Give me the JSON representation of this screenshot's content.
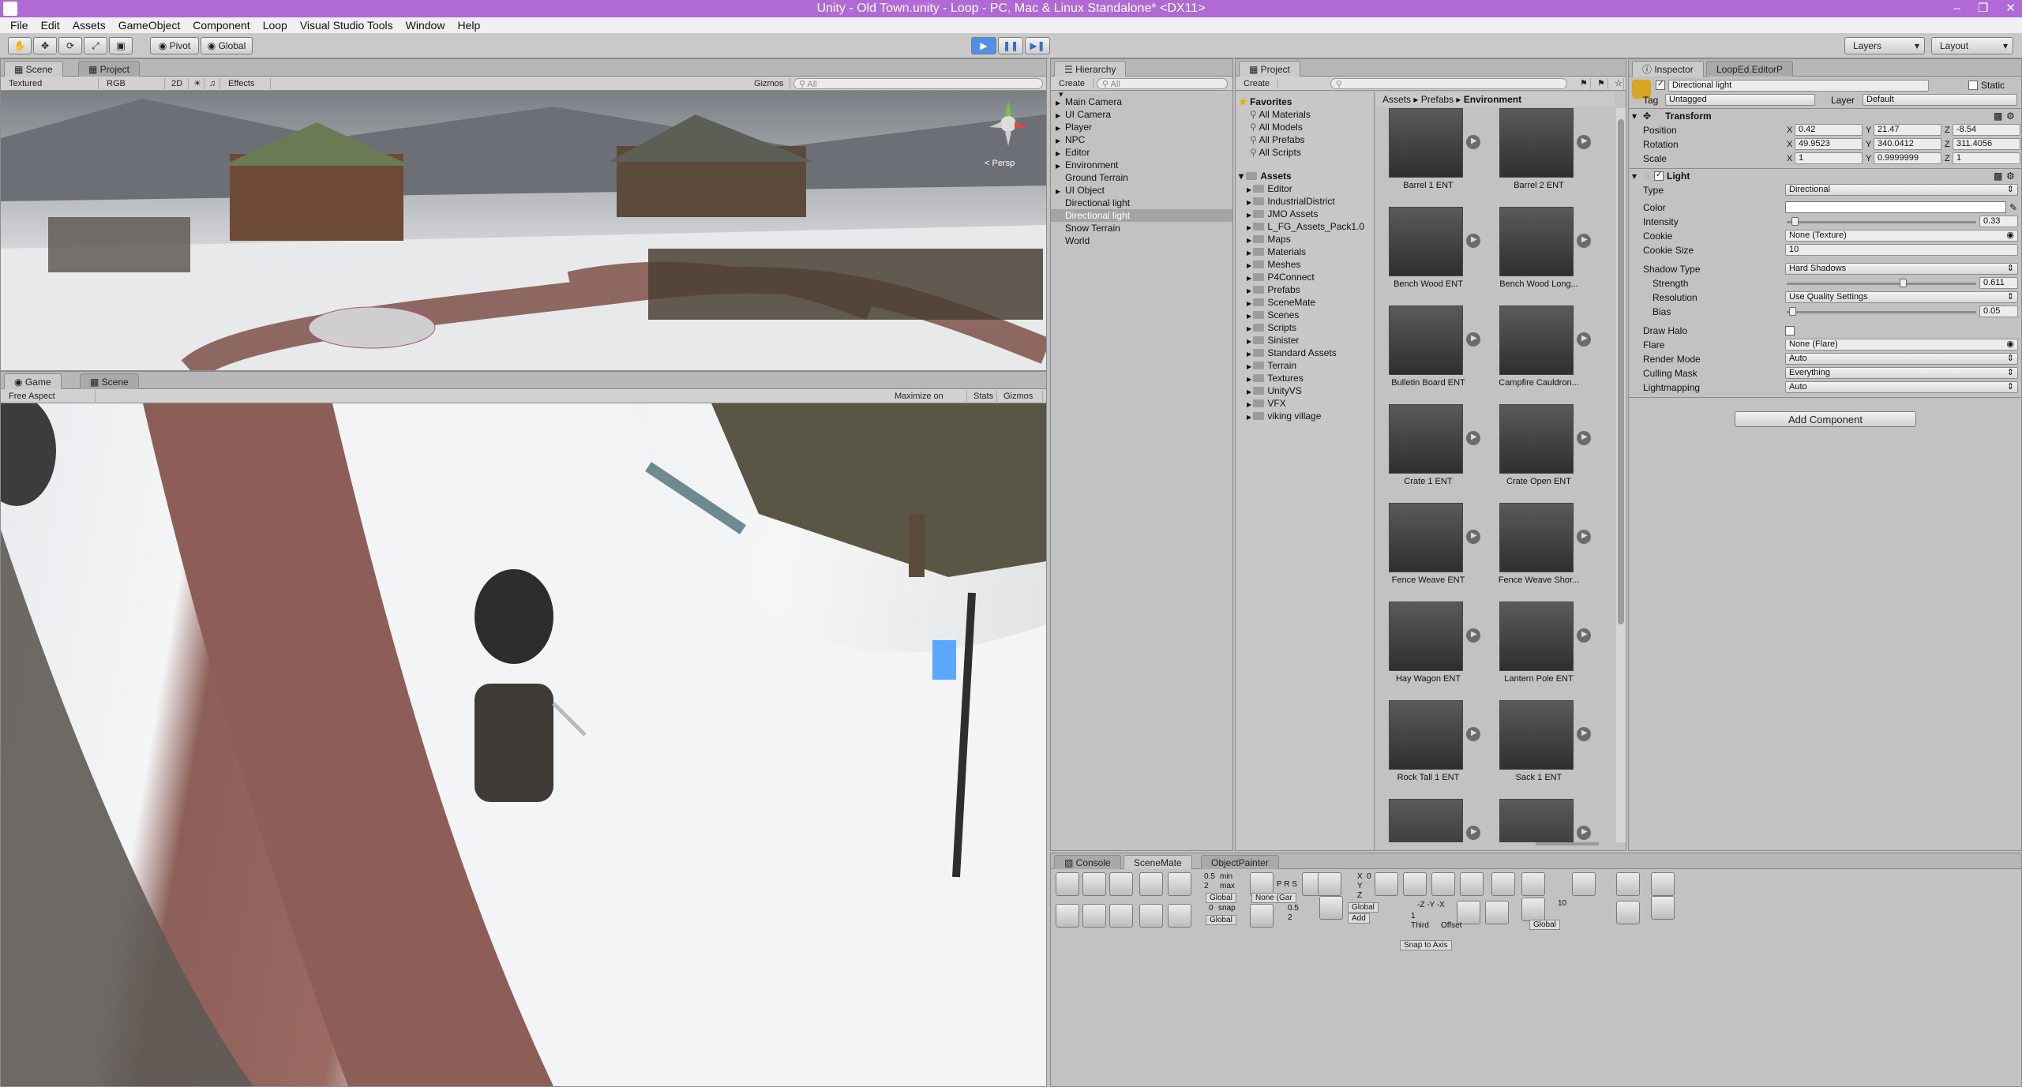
{
  "window": {
    "title": "Unity - Old Town.unity - Loop - PC, Mac & Linux Standalone* <DX11>"
  },
  "menu": [
    "File",
    "Edit",
    "Assets",
    "GameObject",
    "Component",
    "Loop",
    "Visual Studio Tools",
    "Window",
    "Help"
  ],
  "toolbar": {
    "pivot": "Pivot",
    "global": "Global",
    "layers": "Layers",
    "layout": "Layout"
  },
  "scene_panel": {
    "tabs": [
      "Scene",
      "Project"
    ],
    "bar": {
      "textured": "Textured",
      "rgb": "RGB",
      "mode2d": "2D",
      "effects": "Effects",
      "gizmos": "Gizmos",
      "search_placeholder": "All"
    },
    "gizmo_label": "< Persp"
  },
  "game_panel": {
    "tabs": [
      "Game",
      "Scene"
    ],
    "bar": {
      "aspect": "Free Aspect",
      "maximize": "Maximize on Play",
      "stats": "Stats",
      "gizmos": "Gizmos"
    }
  },
  "hierarchy": {
    "tab": "Hierarchy",
    "create": "Create",
    "search_placeholder": "All",
    "items": [
      {
        "label": "Main Camera",
        "expand": true
      },
      {
        "label": "UI Camera",
        "expand": true
      },
      {
        "label": "Player",
        "expand": true
      },
      {
        "label": "NPC",
        "expand": true
      },
      {
        "label": "Editor",
        "expand": true
      },
      {
        "label": "Environment",
        "expand": true
      },
      {
        "label": "Ground Terrain",
        "expand": false
      },
      {
        "label": "UI Object",
        "expand": true
      },
      {
        "label": "Directional light",
        "expand": false
      },
      {
        "label": "Directional light",
        "expand": false,
        "selected": true
      },
      {
        "label": "Snow Terrain",
        "expand": false
      },
      {
        "label": "World",
        "expand": false
      }
    ]
  },
  "project": {
    "tab": "Project",
    "create": "Create",
    "favorites_label": "Favorites",
    "favorites": [
      "All Materials",
      "All Models",
      "All Prefabs",
      "All Scripts"
    ],
    "assets_label": "Assets",
    "folders": [
      "Editor",
      "IndustrialDistrict",
      "JMO Assets",
      "L_FG_Assets_Pack1.0",
      "Maps",
      "Materials",
      "Meshes",
      "P4Connect",
      "Prefabs",
      "SceneMate",
      "Scenes",
      "Scripts",
      "Sinister",
      "Standard Assets",
      "Terrain",
      "Textures",
      "UnityVS",
      "VFX",
      "viking village"
    ],
    "breadcrumb": [
      "Assets",
      "Prefabs",
      "Environment"
    ],
    "assets": [
      "Barrel 1 ENT",
      "Barrel 2 ENT",
      "Bench Wood ENT",
      "Bench Wood Long...",
      "Bulletin Board ENT",
      "Campfire Cauldron...",
      "Crate 1 ENT",
      "Crate Open ENT",
      "Fence Weave ENT",
      "Fence Weave Shor...",
      "Hay Wagon ENT",
      "Lantern Pole ENT",
      "Rock Tall 1 ENT",
      "Sack 1 ENT",
      "",
      ""
    ]
  },
  "inspector": {
    "tabs": [
      "Inspector",
      "LoopEd.EditorP"
    ],
    "object_name": "Directional light",
    "static": "Static",
    "tag_label": "Tag",
    "tag": "Untagged",
    "layer_label": "Layer",
    "layer": "Default",
    "transform": {
      "title": "Transform",
      "position_label": "Position",
      "position": [
        "0.42",
        "21.47",
        "-8.54"
      ],
      "rotation_label": "Rotation",
      "rotation": [
        "49.9523",
        "340.0412",
        "311.4056"
      ],
      "scale_label": "Scale",
      "scale": [
        "1",
        "0.9999999",
        "1"
      ]
    },
    "light": {
      "title": "Light",
      "type_label": "Type",
      "type": "Directional",
      "color_label": "Color",
      "color": "#ffffff",
      "intensity_label": "Intensity",
      "intensity": "0.33",
      "intensity_fraction": 0.04,
      "cookie_label": "Cookie",
      "cookie": "None (Texture)",
      "cookie_size_label": "Cookie Size",
      "cookie_size": "10",
      "shadow_type_label": "Shadow Type",
      "shadow_type": "Hard Shadows",
      "strength_label": "Strength",
      "strength": "0.611",
      "strength_fraction": 0.611,
      "resolution_label": "Resolution",
      "resolution": "Use Quality Settings",
      "bias_label": "Bias",
      "bias": "0.05",
      "bias_fraction": 0.03,
      "draw_halo_label": "Draw Halo",
      "flare_label": "Flare",
      "flare": "None (Flare)",
      "render_mode_label": "Render Mode",
      "render_mode": "Auto",
      "culling_label": "Culling Mask",
      "culling": "Everything",
      "lightmapping_label": "Lightmapping",
      "lightmapping": "Auto"
    },
    "add_component": "Add Component"
  },
  "bottom": {
    "tabs": [
      "Console",
      "SceneMate",
      "ObjectPainter"
    ],
    "texts": {
      "v05": "0.5",
      "v2": "2",
      "min": "min",
      "max": "max",
      "global": "Global",
      "none_gar": "None (Gar",
      "prs": "P R S",
      "snap": "snap",
      "v0": "0",
      "v05b": "0.5",
      "v2b": "2",
      "x": "X",
      "y": "Y",
      "z": "Z",
      "zero": "0",
      "global2": "Global",
      "add": "Add",
      "neg": "-Z  -Y  -X",
      "third": "Third",
      "offset": "Offset",
      "one": "1",
      "snap_axis": "Snap to Axis",
      "ten": "10",
      "global3": "Global"
    }
  },
  "colors": {
    "title_bar": "#b169d6",
    "selection": "#3e7de0",
    "play_active": "#5aa0f0"
  }
}
